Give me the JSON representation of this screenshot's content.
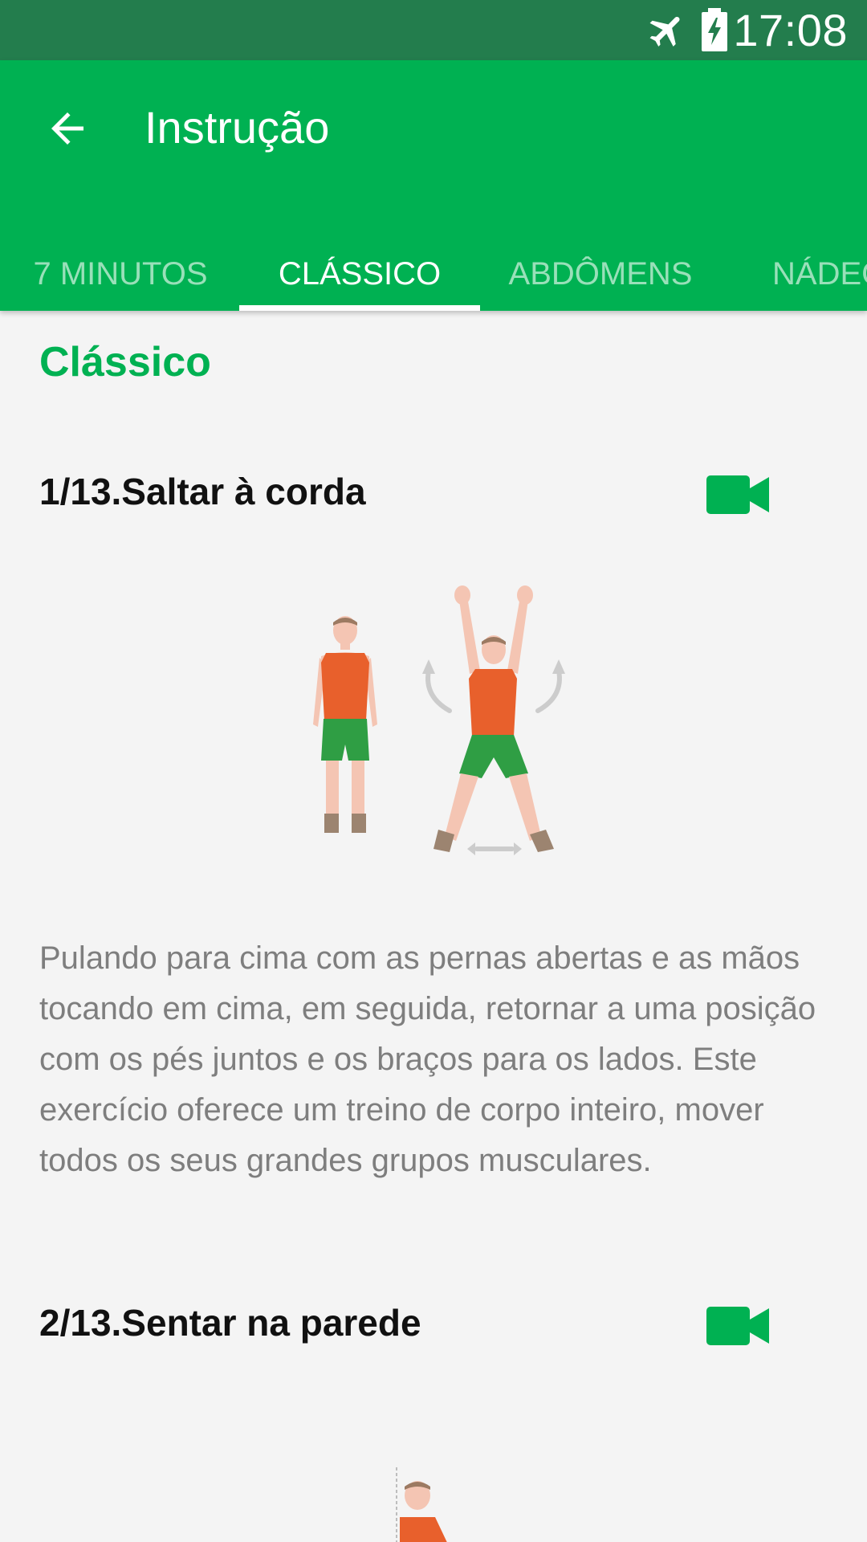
{
  "status_bar": {
    "time": "17:08",
    "icons": [
      "airplane-mode-icon",
      "battery-charging-icon"
    ]
  },
  "app_bar": {
    "title": "Instrução",
    "back_icon": "arrow-back-icon"
  },
  "tabs": [
    {
      "label": "7 MINUTOS",
      "active": false
    },
    {
      "label": "CLÁSSICO",
      "active": true
    },
    {
      "label": "ABDÔMENS",
      "active": false
    },
    {
      "label": "NÁDEGAS",
      "active": false
    }
  ],
  "section": {
    "title": "Clássico"
  },
  "exercises": [
    {
      "title": "1/13.Saltar à corda",
      "video_icon": "video-camera-icon",
      "description": "Pulando para cima com as pernas abertas e as mãos tocando em cima, em seguida, retornar a uma posição com os pés juntos e os braços para os lados. Este exercício oferece um treino de corpo inteiro, mover todos os seus grandes grupos musculares."
    },
    {
      "title": "2/13.Sentar na parede",
      "video_icon": "video-camera-icon"
    }
  ],
  "colors": {
    "primary": "#00b152",
    "status_bar": "#237d4d",
    "background": "#f4f4f4",
    "shirt": "#e8602c",
    "shorts": "#2f9e44"
  }
}
